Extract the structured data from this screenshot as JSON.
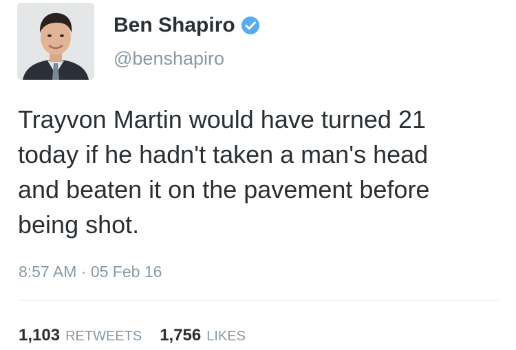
{
  "user": {
    "display_name": "Ben Shapiro",
    "handle": "@benshapiro",
    "verified": true
  },
  "tweet": {
    "text_lines": [
      "Trayvon Martin would have turned 21",
      "today if he hadn't taken a man's head",
      "and beaten it on the pavement before",
      "being shot."
    ],
    "timestamp": "8:57 AM · 05 Feb 16"
  },
  "stats": {
    "retweets_count": "1,103",
    "retweets_label": "RETWEETS",
    "likes_count": "1,756",
    "likes_label": "LIKES"
  },
  "icons": {
    "avatar": "avatar",
    "verified": "verified-badge-icon"
  },
  "colors": {
    "text": "#292f33",
    "secondary": "#8899a6",
    "verified": "#55acee",
    "divider": "#e1e8ed"
  }
}
